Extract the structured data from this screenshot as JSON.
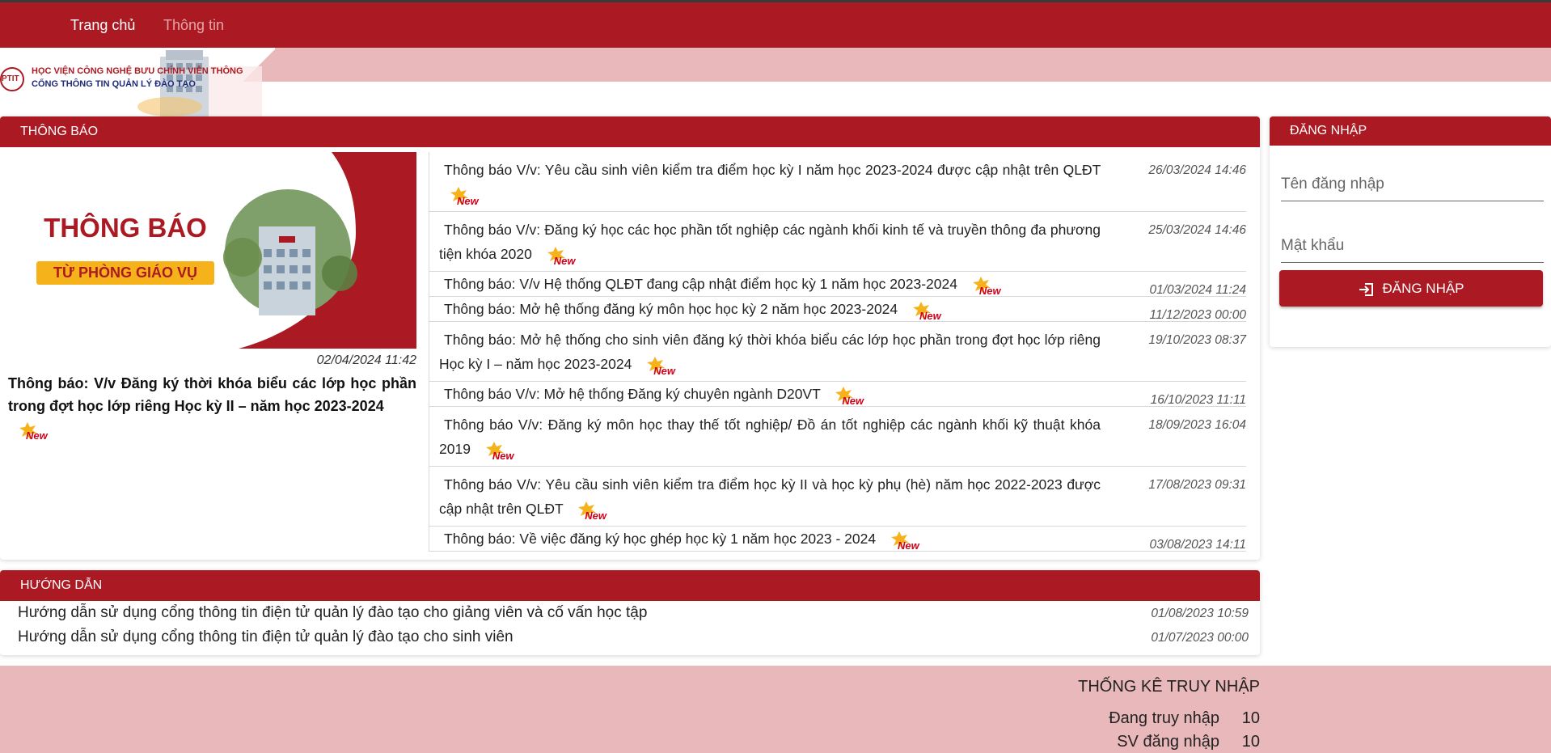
{
  "nav": {
    "home": "Trang chủ",
    "info": "Thông tin"
  },
  "logo": {
    "line1": "HỌC VIỆN CÔNG NGHỆ BƯU CHÍNH VIỄN THÔNG",
    "line2": "CỔNG THÔNG TIN QUẢN LÝ ĐÀO TẠO",
    "mark": "PTIT"
  },
  "notice": {
    "header": "THÔNG BÁO",
    "banner_title": "THÔNG BÁO",
    "banner_sub": "TỪ PHÒNG GIÁO VỤ",
    "featured": {
      "date": "02/04/2024 11:42",
      "title": "Thông báo: V/v Đăng ký thời khóa biểu các lớp học phần trong đợt học lớp riêng Học kỳ II – năm học 2023-2024"
    },
    "new_label": "New",
    "items": [
      {
        "title": "Thông báo V/v: Yêu cầu sinh viên kiểm tra điểm học kỳ I năm học 2023-2024 được cập nhật trên QLĐT",
        "date": "26/03/2024 14:46"
      },
      {
        "title": "Thông báo V/v: Đăng ký học các học phần tốt nghiệp các ngành khối kinh tế và truyền thông đa phương tiện khóa 2020",
        "date": "25/03/2024 14:46"
      },
      {
        "title": "Thông báo: V/v Hệ thống QLĐT đang cập nhật điểm học kỳ 1 năm học 2023-2024",
        "date": "01/03/2024 11:24"
      },
      {
        "title": "Thông báo: Mở hệ thống đăng ký môn học học kỳ 2 năm học 2023-2024",
        "date": "11/12/2023 00:00"
      },
      {
        "title": "Thông báo: Mở hệ thống cho sinh viên đăng ký thời khóa biểu các lớp học phần trong đợt học lớp riêng Học kỳ I – năm học 2023-2024",
        "date": "19/10/2023 08:37"
      },
      {
        "title": "Thông báo V/v: Mở hệ thống Đăng ký chuyên ngành D20VT",
        "date": "16/10/2023 11:11"
      },
      {
        "title": "Thông báo V/v: Đăng ký môn học thay thế tốt nghiệp/ Đồ án tốt nghiệp các ngành khối kỹ thuật khóa 2019",
        "date": "18/09/2023 16:04"
      },
      {
        "title": "Thông báo V/v: Yêu cầu sinh viên kiểm tra điểm học kỳ II và học kỳ phụ (hè) năm học 2022-2023 được cập nhật trên QLĐT",
        "date": "17/08/2023 09:31"
      },
      {
        "title": "Thông báo: Về việc đăng ký học ghép học kỳ 1 năm học 2023 - 2024",
        "date": "03/08/2023 14:11"
      }
    ]
  },
  "guide": {
    "header": "HƯỚNG DẪN",
    "items": [
      {
        "title": "Hướng dẫn sử dụng cổng thông tin điện tử quản lý đào tạo cho giảng viên và cố vấn học tập",
        "date": "01/08/2023 10:59"
      },
      {
        "title": "Hướng dẫn sử dụng cổng thông tin điện tử quản lý đào tạo cho sinh viên",
        "date": "01/07/2023 00:00"
      }
    ]
  },
  "login": {
    "header": "ĐĂNG NHẬP",
    "username_placeholder": "Tên đăng nhập",
    "password_placeholder": "Mật khẩu",
    "button": "ĐĂNG NHẬP"
  },
  "stats": {
    "title": "THỐNG KÊ TRUY NHẬP",
    "online_label": "Đang truy nhập",
    "online_value": "10",
    "sv_label": "SV đăng nhập",
    "sv_value": "10"
  },
  "colors": {
    "brand": "#ab1a22",
    "band": "#e8b8ba",
    "badge": "#f5b21b"
  }
}
